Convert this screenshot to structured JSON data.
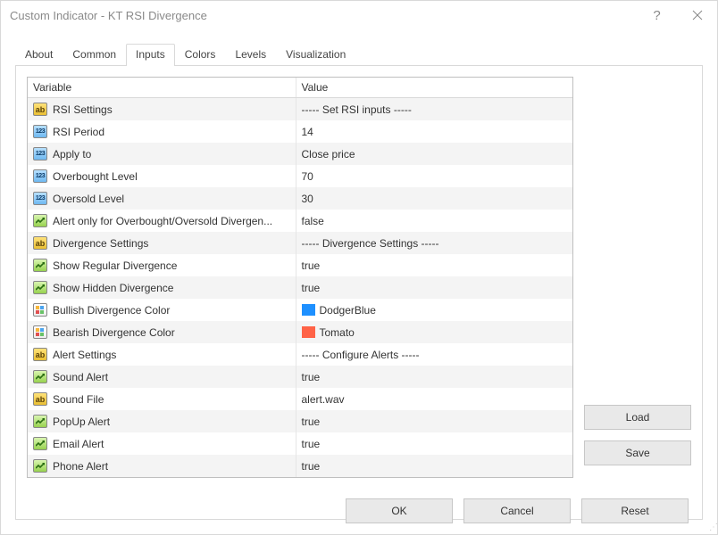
{
  "title": "Custom Indicator - KT RSI Divergence",
  "tabs": [
    "About",
    "Common",
    "Inputs",
    "Colors",
    "Levels",
    "Visualization"
  ],
  "activeTab": 2,
  "headers": {
    "variable": "Variable",
    "value": "Value"
  },
  "rows": [
    {
      "icon": "ab",
      "variable": "RSI Settings",
      "valueType": "text",
      "value": "----- Set RSI inputs -----"
    },
    {
      "icon": "123",
      "variable": "RSI Period",
      "valueType": "text",
      "value": "14"
    },
    {
      "icon": "123",
      "variable": "Apply to",
      "valueType": "text",
      "value": "Close price"
    },
    {
      "icon": "123",
      "variable": "Overbought Level",
      "valueType": "text",
      "value": "70"
    },
    {
      "icon": "123",
      "variable": "Oversold Level",
      "valueType": "text",
      "value": "30"
    },
    {
      "icon": "bool",
      "variable": "Alert only for Overbought/Oversold Divergen...",
      "valueType": "text",
      "value": "false"
    },
    {
      "icon": "ab",
      "variable": "Divergence Settings",
      "valueType": "text",
      "value": "----- Divergence Settings -----"
    },
    {
      "icon": "bool",
      "variable": "Show Regular Divergence",
      "valueType": "text",
      "value": "true"
    },
    {
      "icon": "bool",
      "variable": "Show Hidden Divergence",
      "valueType": "text",
      "value": "true"
    },
    {
      "icon": "color",
      "variable": "Bullish Divergence Color",
      "valueType": "color",
      "value": "DodgerBlue",
      "color": "#1e90ff"
    },
    {
      "icon": "color",
      "variable": "Bearish Divergence Color",
      "valueType": "color",
      "value": "Tomato",
      "color": "#ff6347"
    },
    {
      "icon": "ab",
      "variable": "Alert Settings",
      "valueType": "text",
      "value": "----- Configure Alerts -----"
    },
    {
      "icon": "bool",
      "variable": "Sound Alert",
      "valueType": "text",
      "value": "true"
    },
    {
      "icon": "ab",
      "variable": "Sound File",
      "valueType": "text",
      "value": "alert.wav"
    },
    {
      "icon": "bool",
      "variable": "PopUp Alert",
      "valueType": "text",
      "value": "true"
    },
    {
      "icon": "bool",
      "variable": "Email Alert",
      "valueType": "text",
      "value": "true"
    },
    {
      "icon": "bool",
      "variable": "Phone Alert",
      "valueType": "text",
      "value": "true"
    }
  ],
  "buttons": {
    "load": "Load",
    "save": "Save",
    "ok": "OK",
    "cancel": "Cancel",
    "reset": "Reset"
  }
}
